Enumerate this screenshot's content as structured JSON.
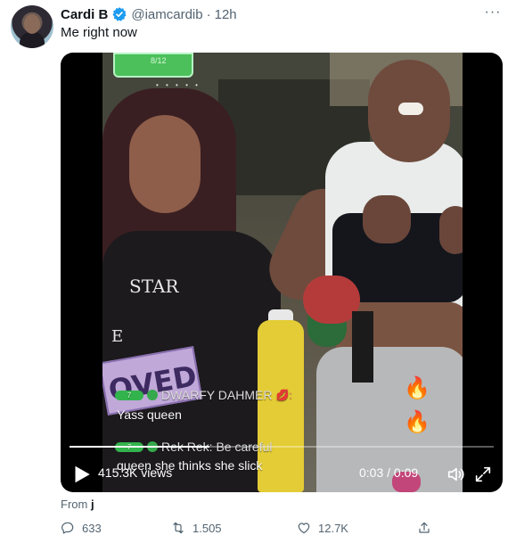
{
  "tweet": {
    "display_name": "Cardi B",
    "handle": "@iamcardib",
    "separator": "·",
    "timestamp": "12h",
    "more_label": "···",
    "text": "Me right now",
    "from_label": "From",
    "from_source": "j"
  },
  "video": {
    "banner_text": "8/12",
    "page_dots": "• • • • •",
    "sign_text": "OVED",
    "shirt_text_1": "STAR",
    "shirt_text_2": "E",
    "chat": [
      {
        "badge": "7",
        "name": "DWARFY DAHMER",
        "heart": "💋:",
        "message": "Yass queen"
      },
      {
        "badge": "7",
        "name": "Rek Rek: Be careful",
        "heart": "",
        "message": "queen she thinks she slick"
      }
    ],
    "views": "415.3K views",
    "time": "0:03 / 0:09",
    "progress_fraction": 0.33
  },
  "actions": {
    "reply_count": "633",
    "retweet_count": "1.505",
    "like_count": "12.7K",
    "share_count": ""
  },
  "colors": {
    "verified": "#1d9bf0",
    "secondary_text": "#536471"
  }
}
